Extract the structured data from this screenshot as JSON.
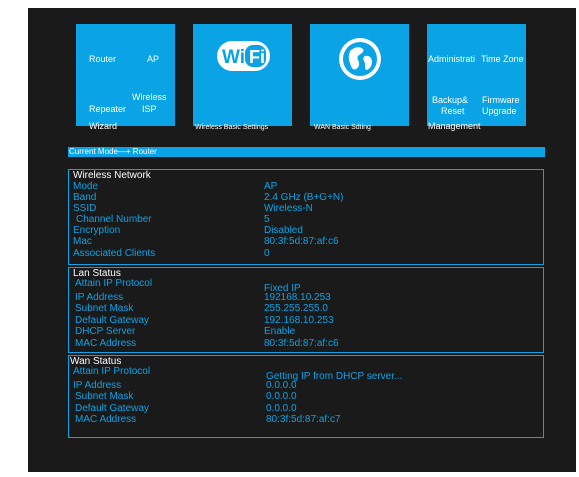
{
  "tiles": {
    "router_ap": {
      "router": "Router",
      "ap": "AP",
      "wireless": "Wireless",
      "repeater": "Repeater",
      "isp": "ISP",
      "wizard": "Wizard"
    },
    "wifi": {
      "logo_text": "Wi Fi",
      "caption": "Wireless Basic Settings",
      "logo_icon": "wifi-logo-icon"
    },
    "wan": {
      "caption": "WAN Basic Sdting",
      "logo_icon": "globe-icon"
    },
    "admin": {
      "administration": "Administrati",
      "timezone": "Time Zone",
      "backup": "Backup&",
      "reset": "Reset",
      "firmware": "Firmware",
      "upgrade": "Upgrade",
      "management": "Management"
    }
  },
  "current_mode": "Current Mode—+ Router",
  "wireless_network": {
    "title": "Wireless Network",
    "rows": [
      {
        "label": "Mode",
        "value": "AP"
      },
      {
        "label": "Band",
        "value": "2.4 GHz (B+G+N)"
      },
      {
        "label": "SSID",
        "value": "Wireless-N"
      },
      {
        "label": "Channel Number",
        "value": "5"
      },
      {
        "label": "Encryption",
        "value": "Disabled"
      },
      {
        "label": "Mac",
        "value": "80:3f:5d:87:af:c6"
      },
      {
        "label": "Associated  Clients",
        "value": "0"
      }
    ]
  },
  "lan_status": {
    "title": "Lan Status",
    "rows": [
      {
        "label": "Attain IP Protocol",
        "value": "Fixed IP"
      },
      {
        "label": "IP Address",
        "value": "192168.10.253"
      },
      {
        "label": "Subnet Mask",
        "value": "255.255.255.0"
      },
      {
        "label": "Default Gateway",
        "value": "192.168.10.253"
      },
      {
        "label": "DHCP Server",
        "value": "Enable"
      },
      {
        "label": "MAC Address",
        "value": "80:3f:5d:87:af:c6"
      }
    ]
  },
  "wan_status": {
    "title": "Wan Status",
    "rows": [
      {
        "label": "Attain IP Protocol",
        "value": "Getting IP from DHCP server..."
      },
      {
        "label": "IP Address",
        "value": "0.0.0.0"
      },
      {
        "label": "Subnet Mask",
        "value": "0.0.0.0"
      },
      {
        "label": "Default Gateway",
        "value": "0.0.0.0"
      },
      {
        "label": "MAC Address",
        "value": "80:3f:5d:87:af:c7"
      }
    ]
  },
  "colors": {
    "accent": "#0aa3e6",
    "panel": "#1a1a1a",
    "text": "#ffffff"
  }
}
